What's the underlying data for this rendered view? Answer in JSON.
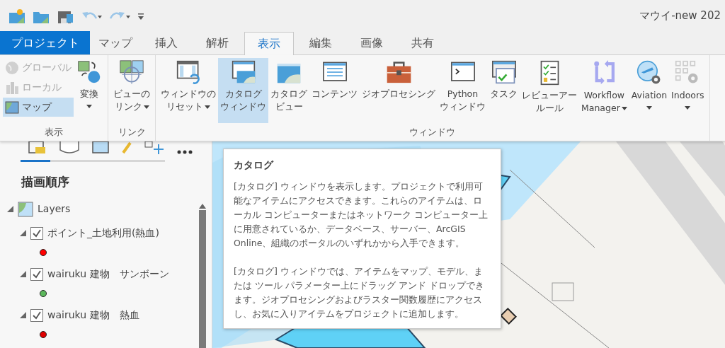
{
  "window": {
    "title": "マウイ-new 202"
  },
  "tabs": [
    {
      "label": "プロジェクト",
      "kind": "backstage",
      "selected": false
    },
    {
      "label": "マップ",
      "kind": "tab",
      "selected": false
    },
    {
      "label": "挿入",
      "kind": "tab",
      "selected": false
    },
    {
      "label": "解析",
      "kind": "tab",
      "selected": false
    },
    {
      "label": "表示",
      "kind": "tab",
      "selected": true
    },
    {
      "label": "編集",
      "kind": "tab",
      "selected": false
    },
    {
      "label": "画像",
      "kind": "tab",
      "selected": false
    },
    {
      "label": "共有",
      "kind": "tab",
      "selected": false
    }
  ],
  "ribbon": {
    "groups": [
      {
        "label": "表示",
        "columns": [
          {
            "kind": "small",
            "items": [
              {
                "label": "グローバル",
                "disabled": true,
                "selected": false
              },
              {
                "label": "ローカル",
                "disabled": true,
                "selected": false
              },
              {
                "label": "マップ",
                "disabled": false,
                "selected": true
              }
            ]
          },
          {
            "kind": "large",
            "items": [
              {
                "lines": [
                  "変換"
                ],
                "dropdown": true,
                "selected": false
              }
            ]
          }
        ]
      },
      {
        "label": "リンク",
        "columns": [
          {
            "kind": "large",
            "items": [
              {
                "lines": [
                  "ビューの",
                  "リンク"
                ],
                "dropdown": true,
                "selected": false
              }
            ]
          }
        ]
      },
      {
        "label": "ウィンドウ",
        "columns": [
          {
            "kind": "large",
            "items": [
              {
                "lines": [
                  "ウィンドウの",
                  "リセット"
                ],
                "dropdown": true,
                "selected": false
              }
            ]
          },
          {
            "kind": "large",
            "items": [
              {
                "lines": [
                  "カタログ",
                  "ウィンドウ"
                ],
                "dropdown": false,
                "selected": true
              }
            ]
          },
          {
            "kind": "large",
            "items": [
              {
                "lines": [
                  "カタログ",
                  "ビュー"
                ],
                "dropdown": false,
                "selected": false
              }
            ]
          },
          {
            "kind": "large",
            "items": [
              {
                "lines": [
                  "コンテンツ"
                ],
                "dropdown": false,
                "selected": false
              }
            ]
          },
          {
            "kind": "large",
            "items": [
              {
                "lines": [
                  "ジオプロセシング"
                ],
                "dropdown": false,
                "selected": false
              }
            ]
          },
          {
            "kind": "large",
            "items": [
              {
                "lines": [
                  "Python",
                  "ウィンドウ"
                ],
                "dropdown": false,
                "selected": false
              }
            ]
          },
          {
            "kind": "large",
            "items": [
              {
                "lines": [
                  "タスク"
                ],
                "dropdown": false,
                "selected": false
              }
            ]
          },
          {
            "kind": "large",
            "items": [
              {
                "lines": [
                  "レビューアー",
                  "ルール"
                ],
                "dropdown": false,
                "selected": false
              }
            ]
          },
          {
            "kind": "large",
            "items": [
              {
                "lines": [
                  "Workflow",
                  "Manager"
                ],
                "dropdown": true,
                "selected": false
              }
            ]
          },
          {
            "kind": "large",
            "items": [
              {
                "lines": [
                  "Aviation"
                ],
                "dropdown": true,
                "selected": false
              }
            ]
          },
          {
            "kind": "large",
            "items": [
              {
                "lines": [
                  "Indoors"
                ],
                "dropdown": true,
                "selected": false
              }
            ]
          }
        ]
      }
    ]
  },
  "contents_pane": {
    "heading": "描画順序",
    "tree": [
      {
        "label": "Layers",
        "expanded": true,
        "children": [
          {
            "label": "ポイント_土地利用(熱血)",
            "expanded": true,
            "checked": true,
            "color": "#ff0000"
          },
          {
            "label": "wairuku 建物　サンボーン",
            "expanded": true,
            "checked": true,
            "color": "#5cb85c"
          },
          {
            "label": "wairuku 建物　熱血",
            "expanded": true,
            "checked": true,
            "color": "#e00000"
          }
        ]
      }
    ]
  },
  "tooltip": {
    "title": "カタログ",
    "paragraphs": [
      "[カタログ] ウィンドウを表示します。プロジェクトで利用可能なアイテムにアクセスできます。これらのアイテムは、ローカル コンピューターまたはネットワーク コンピューター上に用意されているか、データベース、サーバー、ArcGIS Online、組織のポータルのいずれかから入手できます。",
      "[カタログ] ウィンドウでは、アイテムをマップ、モデル、または ツール パラメーター上にドラッグ アンド ドロップできます。ジオプロセシングおよびラスター関数履歴にアクセスし、お気に入りアイテムをプロジェクトに追加します。"
    ]
  }
}
